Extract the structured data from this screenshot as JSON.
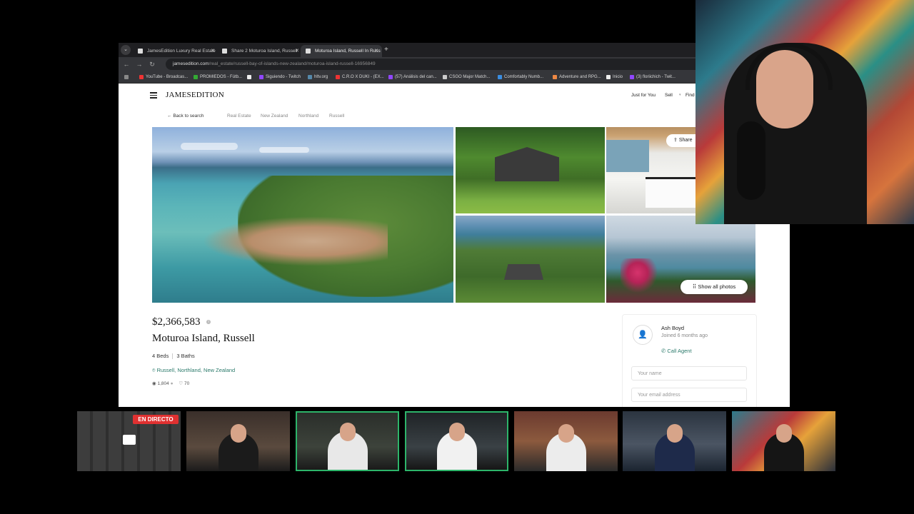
{
  "browser": {
    "tabs": [
      {
        "label": "JamesEdition Luxury Real Estate",
        "active": false
      },
      {
        "label": "Share 2 Moturoa Island, Russell",
        "active": false
      },
      {
        "label": "Moturoa Island, Russell In Russ",
        "active": true
      }
    ],
    "url_host": "jamesedition.com",
    "url_path": "/real_estate/russell-bay-of-islands-new-zealand/moturoa-island-russell-16956849",
    "bookmarks": [
      "YouTube - Broadcas...",
      "PROMIEDOS - Fútb...",
      "",
      "Siguiendo - Twitch",
      "hltv.org",
      "C.R.O X DUKI - (EX...",
      "(57) Análisis del can...",
      "CSGO Major Match...",
      "Comfortably Numb...",
      "Adventure and RPG...",
      "Inicio",
      "(3) floriichich - Twit..."
    ]
  },
  "site": {
    "logo": "JAMESEDITION",
    "nav": [
      "Just for You",
      "Sell",
      "Find"
    ],
    "back_label": "Back to search",
    "breadcrumbs": [
      "Real Estate",
      "New Zealand",
      "Northland",
      "Russell"
    ],
    "share_label": "Share",
    "show_all_label": "Show all photos"
  },
  "listing": {
    "price": "$2,366,583",
    "title": "Moturoa Island, Russell",
    "beds": "4 Beds",
    "baths": "3 Baths",
    "location": "Russell, Northland, New Zealand",
    "views": "1,804",
    "likes": "70"
  },
  "agent": {
    "name": "Ash Boyd",
    "joined": "Joined 6 months ago",
    "call_label": "Call Agent",
    "name_placeholder": "Your name",
    "email_placeholder": "Your email address"
  },
  "stream": {
    "live_label": "EN DIRECTO"
  },
  "colors": {
    "accent_green": "#2b7a6b",
    "live_red": "#e03131",
    "tile_border": "#2db56a"
  }
}
